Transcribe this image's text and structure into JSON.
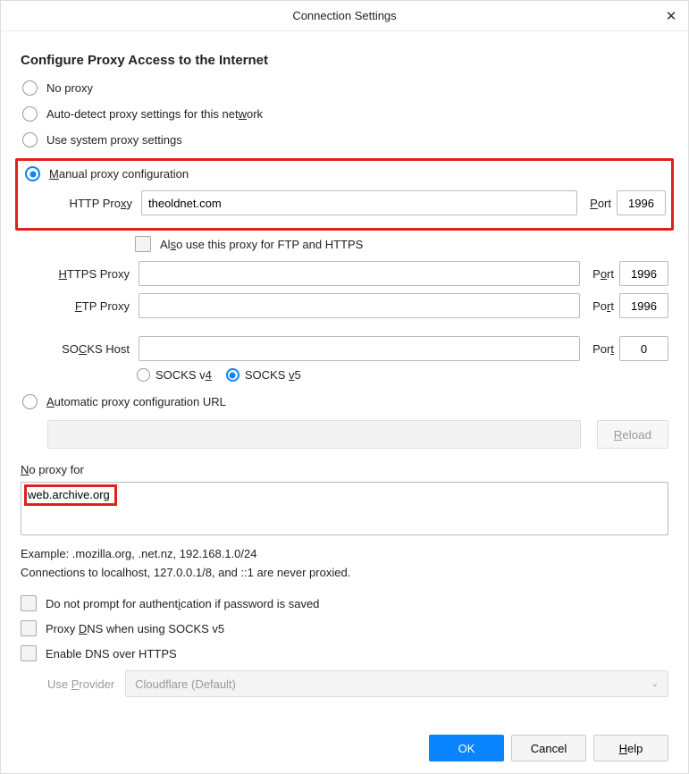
{
  "title": "Connection Settings",
  "heading": "Configure Proxy Access to the Internet",
  "radios": {
    "no_proxy": "No proxy",
    "auto_detect_pre": "Auto-detect proxy settings for this net",
    "auto_detect_u": "w",
    "auto_detect_post": "ork",
    "use_system": "Use system proxy settings",
    "manual_u": "M",
    "manual_post": "anual proxy configuration",
    "auto_pac_u": "A",
    "auto_pac_post": "utomatic proxy configuration URL"
  },
  "proxy": {
    "http": {
      "label_pre": "HTTP Pro",
      "label_u": "x",
      "label_post": "y",
      "value": "theoldnet.com",
      "port_u": "P",
      "port_post": "ort",
      "port": "1996"
    },
    "also_checkbox_pre": "Al",
    "also_checkbox_u": "s",
    "also_checkbox_post": "o use this proxy for FTP and HTTPS",
    "https": {
      "label_u": "H",
      "label_post": "TTPS Proxy",
      "value": "",
      "port_pre": "P",
      "port_u": "o",
      "port_post": "rt",
      "port": "1996"
    },
    "ftp": {
      "label_u": "F",
      "label_post": "TP Proxy",
      "value": "",
      "port_pre": "Po",
      "port_u": "r",
      "port_post": "t",
      "port": "1996"
    },
    "socks": {
      "label_pre": "SO",
      "label_u": "C",
      "label_post": "KS Host",
      "value": "",
      "port_pre": "Por",
      "port_u": "t",
      "port_post": "",
      "port": "0"
    },
    "socks_v4_pre": "SOCKS v",
    "socks_v4_u": "4",
    "socks_v5_pre": "SOCKS ",
    "socks_v5_u": "v",
    "socks_v5_post": "5"
  },
  "pac": {
    "value": "",
    "reload_u": "R",
    "reload_post": "eload"
  },
  "noproxy": {
    "label_u": "N",
    "label_post": "o proxy for",
    "value": "web.archive.org"
  },
  "example": "Example: .mozilla.org, .net.nz, 192.168.1.0/24",
  "hint": "Connections to localhost, 127.0.0.1/8, and ::1 are never proxied.",
  "checkboxes": {
    "noprompt_pre": "Do not prompt for authent",
    "noprompt_u": "i",
    "noprompt_post": "cation if password is saved",
    "proxydns_pre": "Proxy ",
    "proxydns_u": "D",
    "proxydns_post": "NS when using SOCKS v5",
    "doh_pre": "Enable DNS over HTTPS"
  },
  "provider": {
    "label_pre": "Use ",
    "label_u": "P",
    "label_post": "rovider",
    "selected": "Cloudflare (Default)"
  },
  "buttons": {
    "ok": "OK",
    "cancel": "Cancel",
    "help": "Help",
    "help_u": "H",
    "help_post": "elp"
  }
}
